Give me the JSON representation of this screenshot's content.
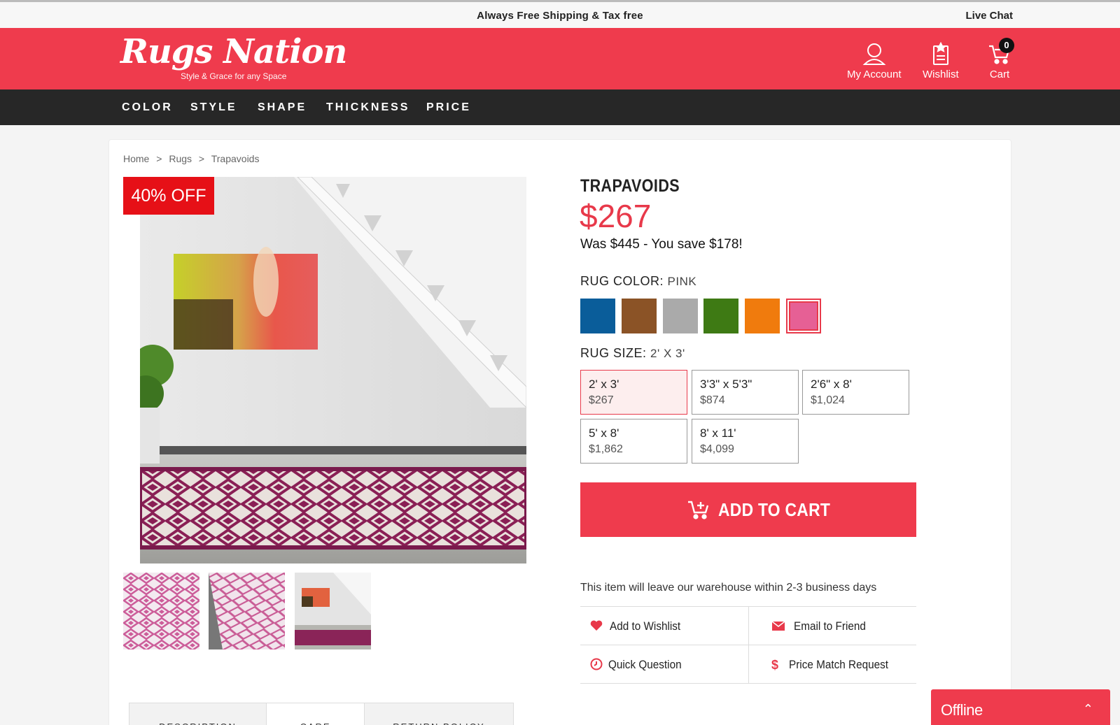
{
  "topbar": {
    "shipping": "Always Free Shipping & Tax free",
    "live_chat": "Live Chat"
  },
  "header": {
    "logo_name": "Rugs Nation",
    "logo_tagline": "Style & Grace for any Space",
    "my_account": "My Account",
    "wishlist": "Wishlist",
    "cart": "Cart",
    "cart_count": "0"
  },
  "nav": [
    "COLOR",
    "STYLE",
    "SHAPE",
    "THICKNESS",
    "PRICE"
  ],
  "breadcrumb": [
    "Home",
    ">",
    "Rugs",
    ">",
    "Trapavoids"
  ],
  "product": {
    "discount_badge": "40% OFF",
    "title": "TRAPAVOIDS",
    "price": "$267",
    "was": "Was $445 - You save $178!",
    "color_label": "RUG COLOR: ",
    "color_value": "PINK",
    "colors": [
      "#0a5d9a",
      "#8b5326",
      "#aaaaaa",
      "#3e7a14",
      "#f07b0d",
      "#e66095"
    ],
    "selected_color": "#e66095",
    "size_label": "RUG SIZE: ",
    "size_value": "2' X 3'",
    "sizes": [
      {
        "dim": "2' x 3'",
        "price": "$267"
      },
      {
        "dim": "3'3\" x 5'3\"",
        "price": "$874"
      },
      {
        "dim": "2'6\" x 8'",
        "price": "$1,024"
      },
      {
        "dim": "5' x 8'",
        "price": "$1,862"
      },
      {
        "dim": "8' x 11'",
        "price": "$4,099"
      }
    ],
    "add_to_cart": "ADD TO CART",
    "shipping_note": "This item will leave our warehouse within 2-3 business days"
  },
  "actions": [
    "Add to Wishlist",
    "Email to Friend",
    "Quick Question",
    "Price Match Request"
  ],
  "tabs": [
    "DESCRIPTION",
    "CARE",
    "RETURN POLICY"
  ],
  "chat_widget": {
    "status": "Offline"
  },
  "colors": {
    "brand_red": "#ef3b4d",
    "nav_dark": "#272727",
    "badge_red": "#e61017"
  }
}
